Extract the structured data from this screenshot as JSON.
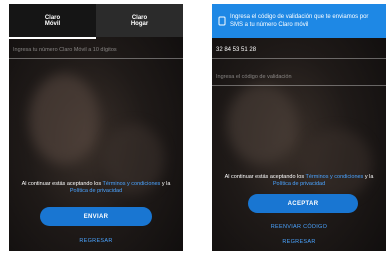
{
  "screen_left": {
    "tabs": [
      {
        "label_line1": "Claro",
        "label_line2": "Móvil"
      },
      {
        "label_line1": "Claro",
        "label_line2": "Hogar"
      }
    ],
    "phone_input": {
      "placeholder": "Ingresa tu número Claro Móvil a 10 dígitos"
    },
    "terms": {
      "prefix": "Al continuar estás aceptando los",
      "terms_link": "Términos y condiciones",
      "connector": "y la",
      "privacy_link": "Política de privacidad"
    },
    "enviar_button": "ENVIAR",
    "secondary_link": "REGRESAR"
  },
  "screen_right": {
    "banner": {
      "text": "Ingresa el código de validación que te enviamos por SMS a tu número Claro móvil"
    },
    "phone_value": "32 84 53 51 28",
    "code_input": {
      "placeholder": "Ingresa el código de validación"
    },
    "terms": {
      "prefix": "Al continuar estás aceptando los",
      "terms_link": "Términos y condiciones",
      "connector": "y la",
      "privacy_link": "Política de privacidad"
    },
    "aceptar_button": "ACEPTAR",
    "resend_link": "REENVIAR CÓDIGO",
    "back_link": "REGRESAR"
  },
  "colors": {
    "accent": "#1976d2",
    "link": "#4aa3ff",
    "banner": "#1e88e5"
  }
}
